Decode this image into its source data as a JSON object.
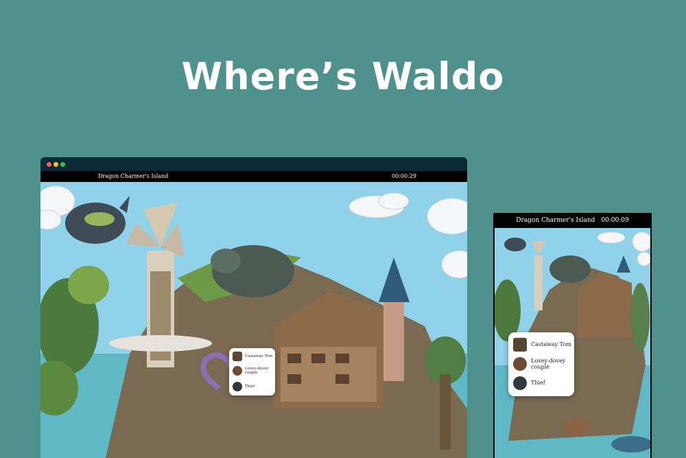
{
  "hero": {
    "title": "Where’s Waldo"
  },
  "desktop": {
    "level_title": "Dragon Charmer's Island",
    "timer": "00:00:29",
    "targets": [
      {
        "name": "Castaway Tom",
        "icon": "castaway-tom-icon"
      },
      {
        "name": "Lovey-dovey couple",
        "icon": "lovey-dovey-couple-icon"
      },
      {
        "name": "Thief",
        "icon": "thief-icon"
      }
    ]
  },
  "mobile": {
    "level_title": "Dragon Charmer's Island",
    "timer": "00:00:09",
    "targets": [
      {
        "name": "Castaway Tom",
        "icon": "castaway-tom-icon"
      },
      {
        "name": "Lovey-dovey couple",
        "icon": "lovey-dovey-couple-icon"
      },
      {
        "name": "Thief",
        "icon": "thief-icon"
      }
    ]
  },
  "colors": {
    "background": "#4f918d",
    "window_bar": "#0b2a35",
    "sky": "#8fd2ea",
    "sea": "#5fb8c4"
  }
}
